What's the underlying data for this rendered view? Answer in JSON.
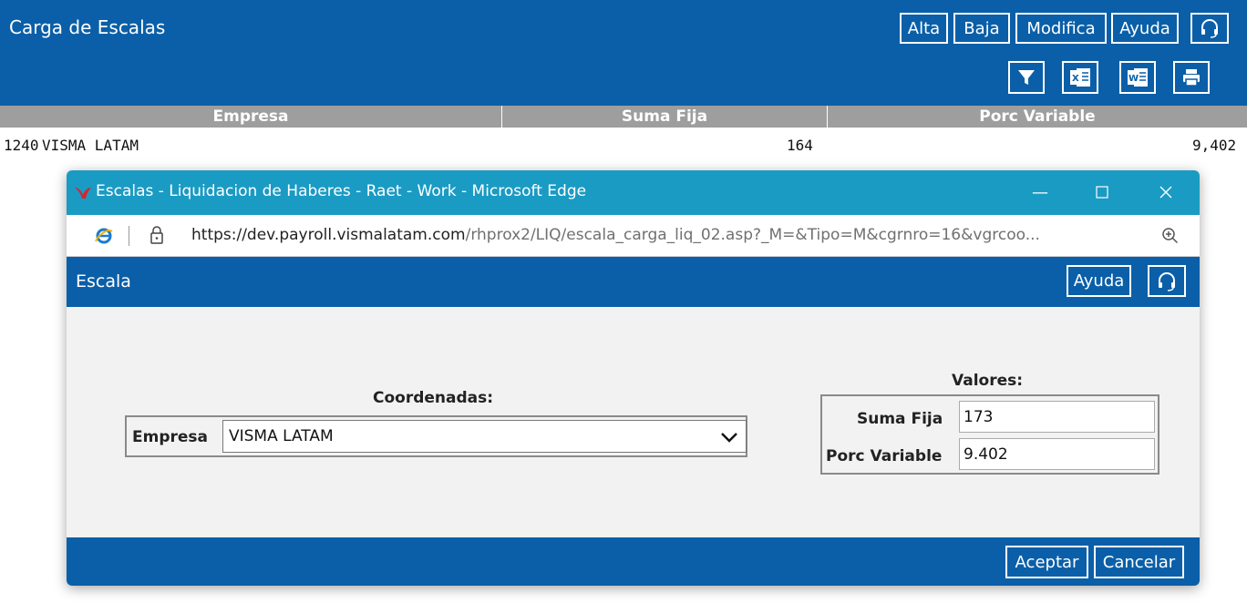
{
  "app": {
    "title": "Carga de Escalas",
    "buttons": {
      "alta": "Alta",
      "baja": "Baja",
      "modifica": "Modifica",
      "ayuda": "Ayuda"
    },
    "icons": [
      "headset-icon",
      "filter-icon",
      "excel-icon",
      "word-icon",
      "print-icon"
    ]
  },
  "grid": {
    "columns": [
      "Empresa",
      "Suma Fija",
      "Porc Variable"
    ],
    "rows": [
      {
        "codigo": "1240",
        "empresa": "VISMA LATAM",
        "suma_fija": "164",
        "porc_variable": "9,402"
      }
    ]
  },
  "browser": {
    "title": "Escalas - Liquidacion de Haberes - Raet - Work - Microsoft Edge",
    "url_host": "https://dev.payroll.vismalatam.com",
    "url_path": "/rhprox2/LIQ/escala_carga_liq_02.asp?_M=&Tipo=M&cgrnro=16&vgrcoo..."
  },
  "dialog": {
    "title": "Escala",
    "ayuda": "Ayuda",
    "coordenadas_label": "Coordenadas:",
    "empresa_label": "Empresa",
    "empresa_value": "VISMA LATAM",
    "valores_label": "Valores:",
    "suma_fija_label": "Suma Fija",
    "suma_fija_value": "173",
    "porc_variable_label": "Porc Variable",
    "porc_variable_value": "9.402",
    "aceptar": "Aceptar",
    "cancelar": "Cancelar"
  },
  "colors": {
    "header_blue": "#0a5fa8",
    "edge_titlebar": "#1a9bc4",
    "grid_header": "#9e9e9e"
  }
}
